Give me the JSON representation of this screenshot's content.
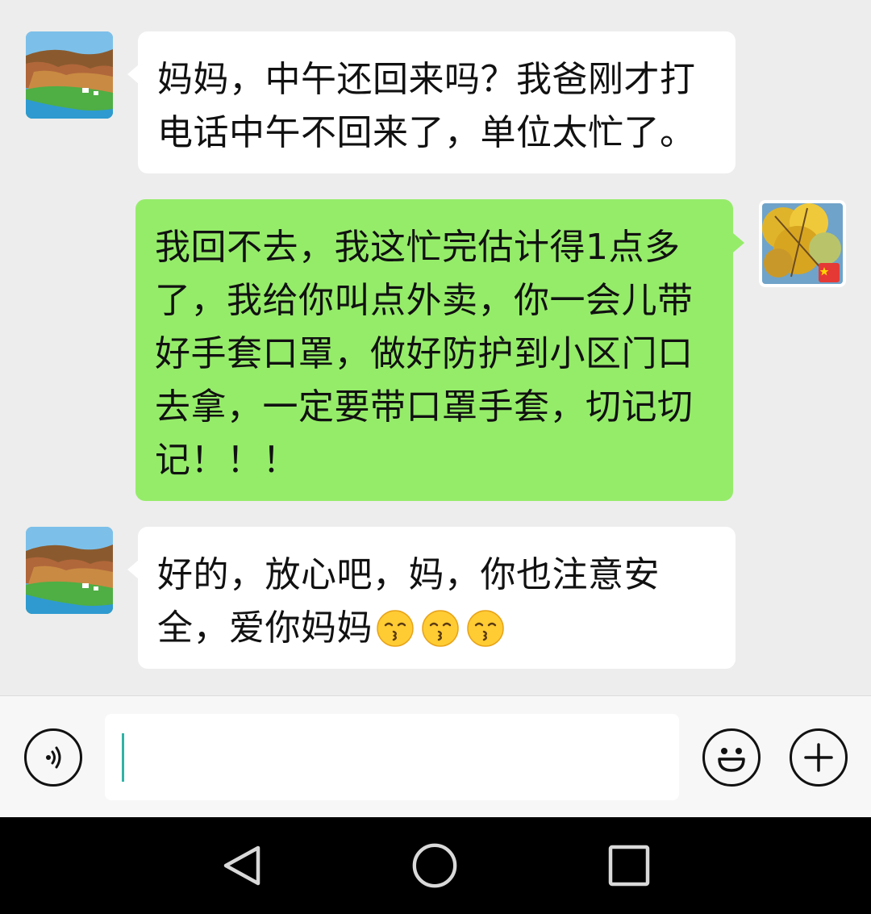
{
  "messages": [
    {
      "direction": "incoming",
      "text": "妈妈，中午还回来吗？我爸刚才打电话中午不回来了，单位太忙了。"
    },
    {
      "direction": "outgoing",
      "text": "我回不去，我这忙完估计得1点多了，我给你叫点外卖，你一会儿带好手套口罩，做好防护到小区门口去拿，一定要带口罩手套，切记切记！！！"
    },
    {
      "direction": "incoming",
      "text": "好的，放心吧，妈，你也注意安全，爱你妈妈",
      "emoji": [
        "kissing-face-icon",
        "kissing-face-icon",
        "kissing-face-icon"
      ]
    }
  ],
  "input_bar": {
    "text_value": "",
    "voice_icon": "voice-icon",
    "emoji_icon": "smiley-icon",
    "more_icon": "plus-icon"
  },
  "navigation": {
    "back_icon": "back-triangle-icon",
    "home_icon": "home-circle-icon",
    "recents_icon": "recents-square-icon"
  },
  "colors": {
    "chat_background": "#ededed",
    "incoming_bubble": "#ffffff",
    "outgoing_bubble": "#95ec69",
    "cursor": "#2fb3a5",
    "nav_bar": "#000000"
  }
}
